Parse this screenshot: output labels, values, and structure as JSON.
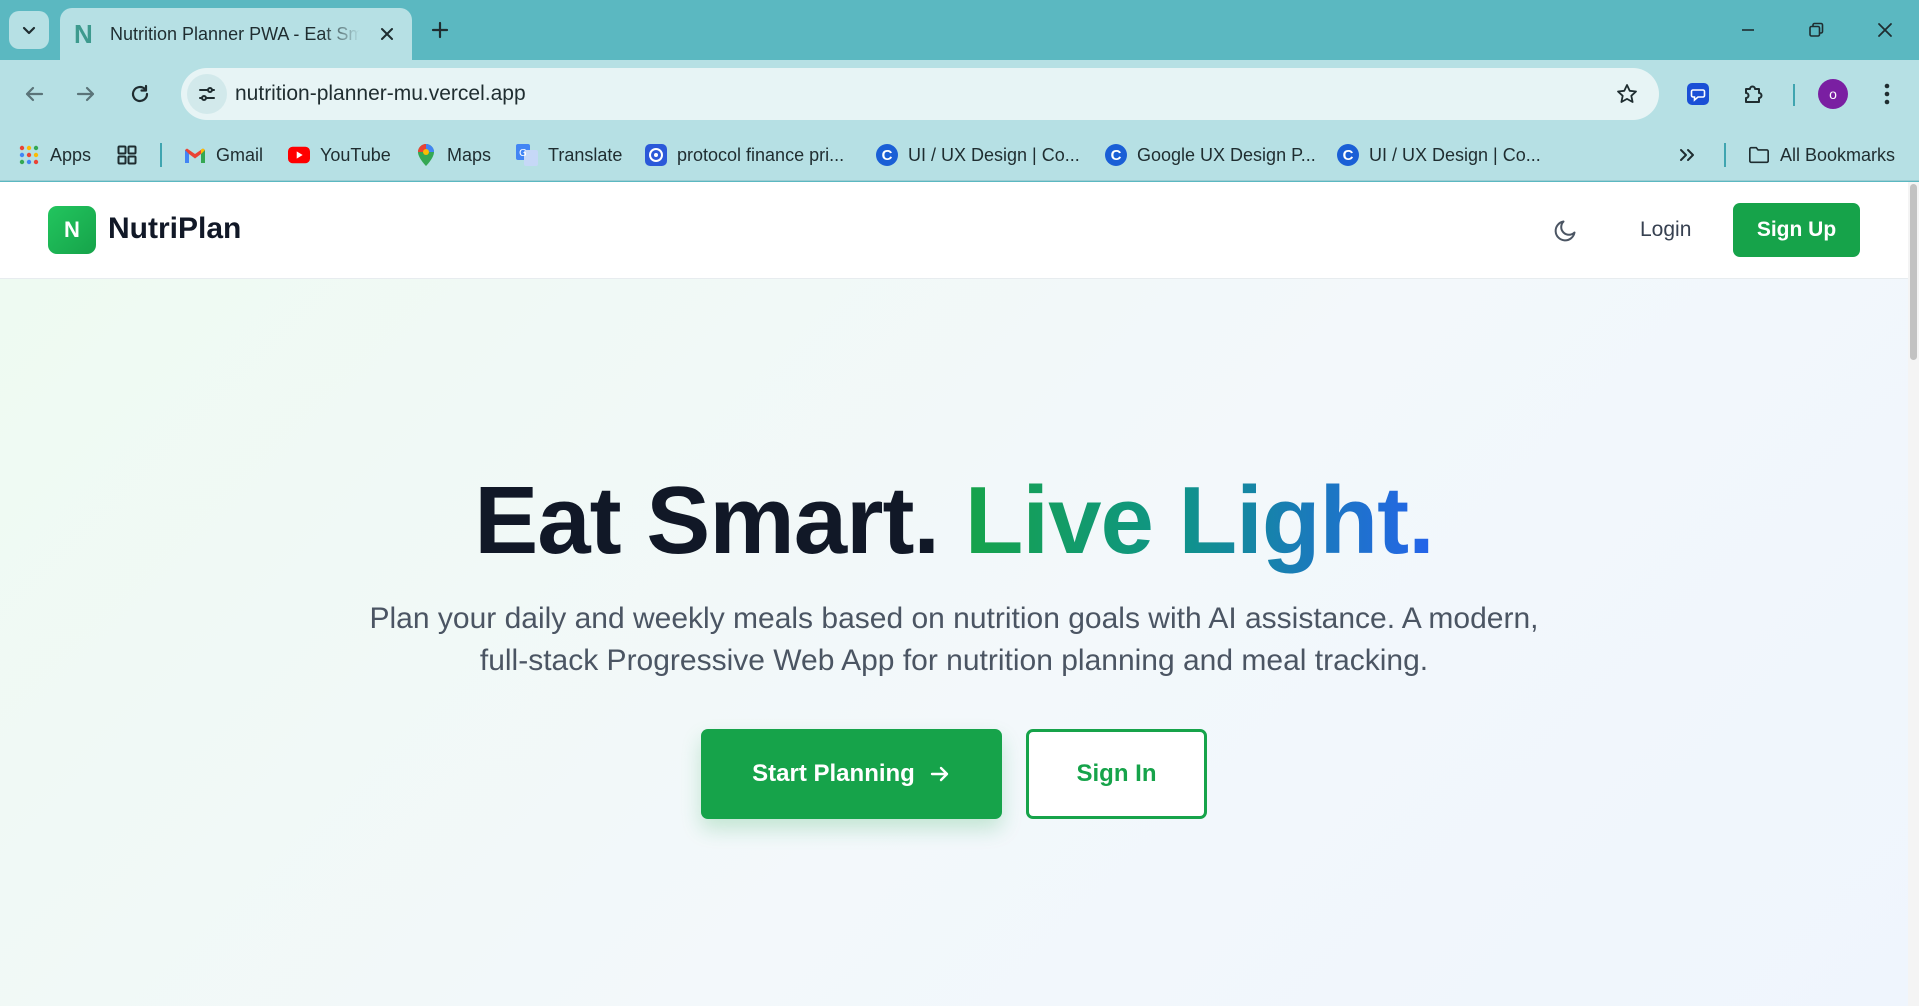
{
  "browser": {
    "tab": {
      "favicon": "N",
      "title": "Nutrition Planner PWA - Eat Smart. Live Light."
    },
    "address_bar": {
      "url": "nutrition-planner-mu.vercel.app"
    },
    "profile_initial": "o"
  },
  "bookmarks": {
    "items": [
      {
        "label": "Apps",
        "icon": "apps-grid-icon"
      },
      {
        "label": "Gmail",
        "icon": "gmail-icon"
      },
      {
        "label": "YouTube",
        "icon": "youtube-icon"
      },
      {
        "label": "Maps",
        "icon": "maps-pin-icon"
      },
      {
        "label": "Translate",
        "icon": "translate-icon"
      },
      {
        "label": "protocol finance pri...",
        "icon": "protocol-icon"
      },
      {
        "label": "UI / UX Design | Co...",
        "icon": "coursera-icon"
      },
      {
        "label": "Google UX Design P...",
        "icon": "coursera-icon"
      },
      {
        "label": "UI / UX Design | Co...",
        "icon": "coursera-icon"
      }
    ],
    "all_bookmarks": "All Bookmarks"
  },
  "app": {
    "logo_mark": "N",
    "brand": "NutriPlan",
    "login": "Login",
    "signup": "Sign Up"
  },
  "hero": {
    "title_dark": "Eat Smart.",
    "title_accent": "Live Light.",
    "subtitle": "Plan your daily and weekly meals based on nutrition goals with AI assistance. A modern, full-stack Progressive Web App for nutrition planning and meal tracking.",
    "primary_cta": "Start Planning",
    "secondary_cta": "Sign In"
  },
  "colors": {
    "brand_green": "#16a34a",
    "gradient_end_blue": "#2563eb",
    "browser_frame": "#5bb8c1"
  }
}
